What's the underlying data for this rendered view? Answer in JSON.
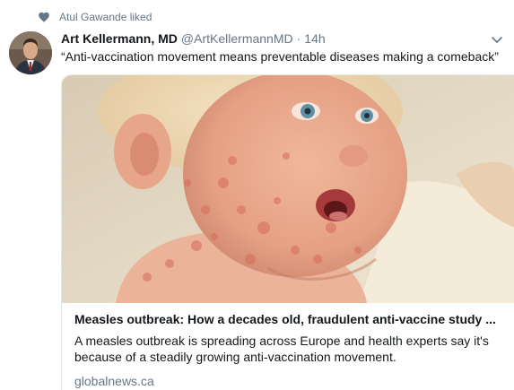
{
  "context": {
    "icon": "heart-icon",
    "text": "Atul Gawande liked"
  },
  "tweet": {
    "author_name": "Art Kellermann, MD",
    "handle": "@ArtKellermannMD",
    "separator": "·",
    "time": "14h",
    "text": "“Anti-vaccination movement means preventable diseases making a comeback”",
    "menu_icon": "chevron-down-icon"
  },
  "card": {
    "image_subject": "child-with-measles-rash",
    "title": "Measles outbreak: How a decades old, fraudulent anti-vaccine study ...",
    "description": "A measles outbreak is spreading across Europe and health experts say it's because of a steadily growing anti-vaccination movement.",
    "domain": "globalnews.ca"
  },
  "colors": {
    "primary_text": "#14171a",
    "secondary_text": "#657786",
    "border": "#e1e8ed"
  }
}
